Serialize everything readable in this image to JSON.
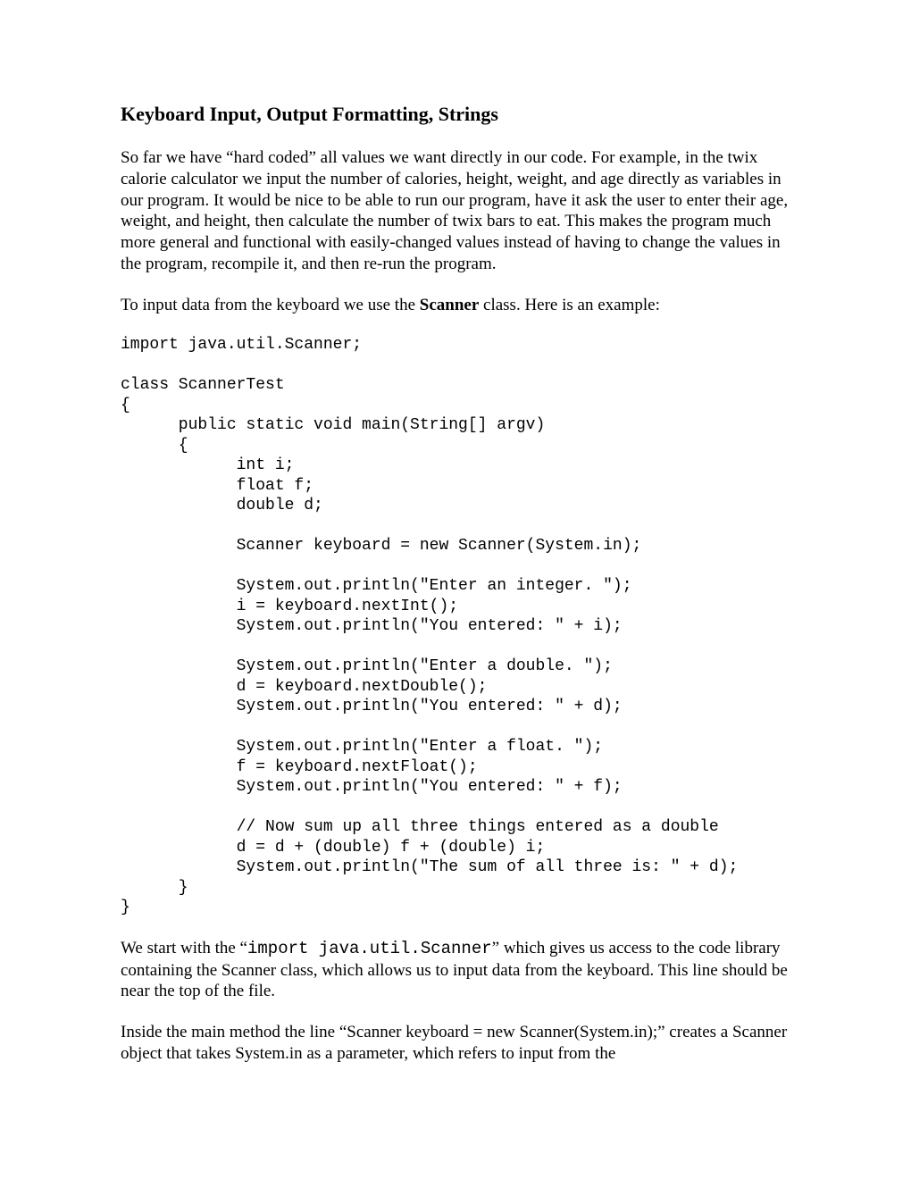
{
  "title": "Keyboard Input, Output Formatting, Strings",
  "p1": "So far we have “hard coded” all values we want directly in our code.  For example, in the twix calorie calculator we input the number of calories, height, weight, and age directly as variables in our program.  It would be nice to be able to run our program, have it ask the user to enter their age, weight, and height, then calculate the number of twix bars to eat.   This makes the program much more general and functional with easily-changed values instead of having to change the values in the program, recompile it, and then re-run the program.",
  "p2_pre": "To input data from the keyboard we use the ",
  "p2_bold": "Scanner",
  "p2_post": " class.  Here is an example:",
  "code": "import java.util.Scanner;\n\nclass ScannerTest\n{\n      public static void main(String[] argv)\n      {\n            int i;\n            float f;\n            double d;\n\n            Scanner keyboard = new Scanner(System.in);\n\n            System.out.println(\"Enter an integer. \");\n            i = keyboard.nextInt();\n            System.out.println(\"You entered: \" + i);\n\n            System.out.println(\"Enter a double. \");\n            d = keyboard.nextDouble();\n            System.out.println(\"You entered: \" + d);\n\n            System.out.println(\"Enter a float. \");\n            f = keyboard.nextFloat();\n            System.out.println(\"You entered: \" + f);\n\n            // Now sum up all three things entered as a double\n            d = d + (double) f + (double) i;\n            System.out.println(\"The sum of all three is: \" + d);\n      }\n}",
  "p3_pre": "We start with the “",
  "p3_mono": "import java.util.Scanner",
  "p3_post": "” which gives us access to the code library containing the Scanner class, which allows us to input data from the keyboard.  This line should be near the top of the file.",
  "p4": "Inside the main method the line “Scanner keyboard = new Scanner(System.in);” creates a Scanner object that takes System.in as a parameter, which refers to input from the"
}
